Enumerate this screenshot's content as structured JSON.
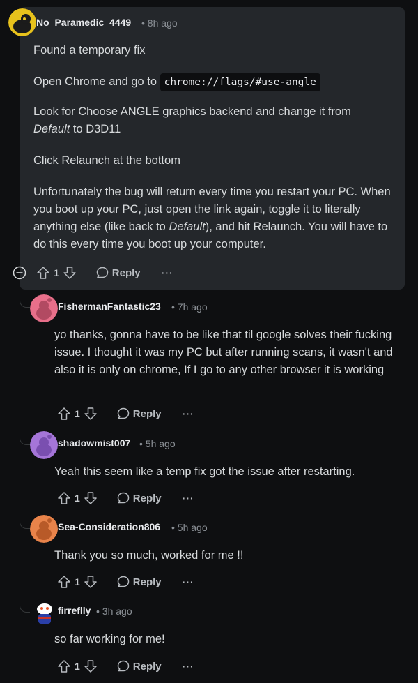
{
  "comments": [
    {
      "username": "No_Paramedic_4449",
      "time": "8h ago",
      "paragraphs": {
        "p1": "Found a temporary fix",
        "p2_pre": "Open Chrome and go to ",
        "p2_code": "chrome://flags/#use-angle",
        "p3_a": "Look for Choose ANGLE graphics backend and change it from",
        "p3_em": "Default",
        "p3_b": " to D3D11",
        "p4": "Click Relaunch at the bottom",
        "p5_a": "Unfortunately the bug will return every time you restart your PC. When you boot up your PC, just open the link again, toggle it to literally anything else (like back to ",
        "p5_em": "Default",
        "p5_b": "), and hit Relaunch. You will have to do this every time you boot up your computer."
      },
      "votes": "1"
    },
    {
      "username": "FishermanFantastic23",
      "time": "7h ago",
      "text": "yo thanks, gonna have to be like that til google solves their fucking issue. I thought it was my PC but after running scans, it wasn't and also it is only on chrome, If I go to any other browser it is working",
      "votes": "1"
    },
    {
      "username": "shadowmist007",
      "time": "5h ago",
      "text": "Yeah this seem like a temp fix got the issue after restarting.",
      "votes": "1"
    },
    {
      "username": "Sea-Consideration806",
      "time": "5h ago",
      "text": "Thank you so much, worked for me !!",
      "votes": "1"
    },
    {
      "username": "firreflly",
      "time": "3h ago",
      "text": "so far working for me!",
      "votes": "1"
    }
  ],
  "labels": {
    "reply": "Reply",
    "more": "···",
    "sep": "•"
  },
  "colors": {
    "avatar_yellow": "#e8c21c",
    "avatar_pink": "#e86f8a",
    "avatar_purple": "#a575d8",
    "avatar_orange": "#e8834a",
    "avatar_snoo": "#2a3fa8"
  }
}
